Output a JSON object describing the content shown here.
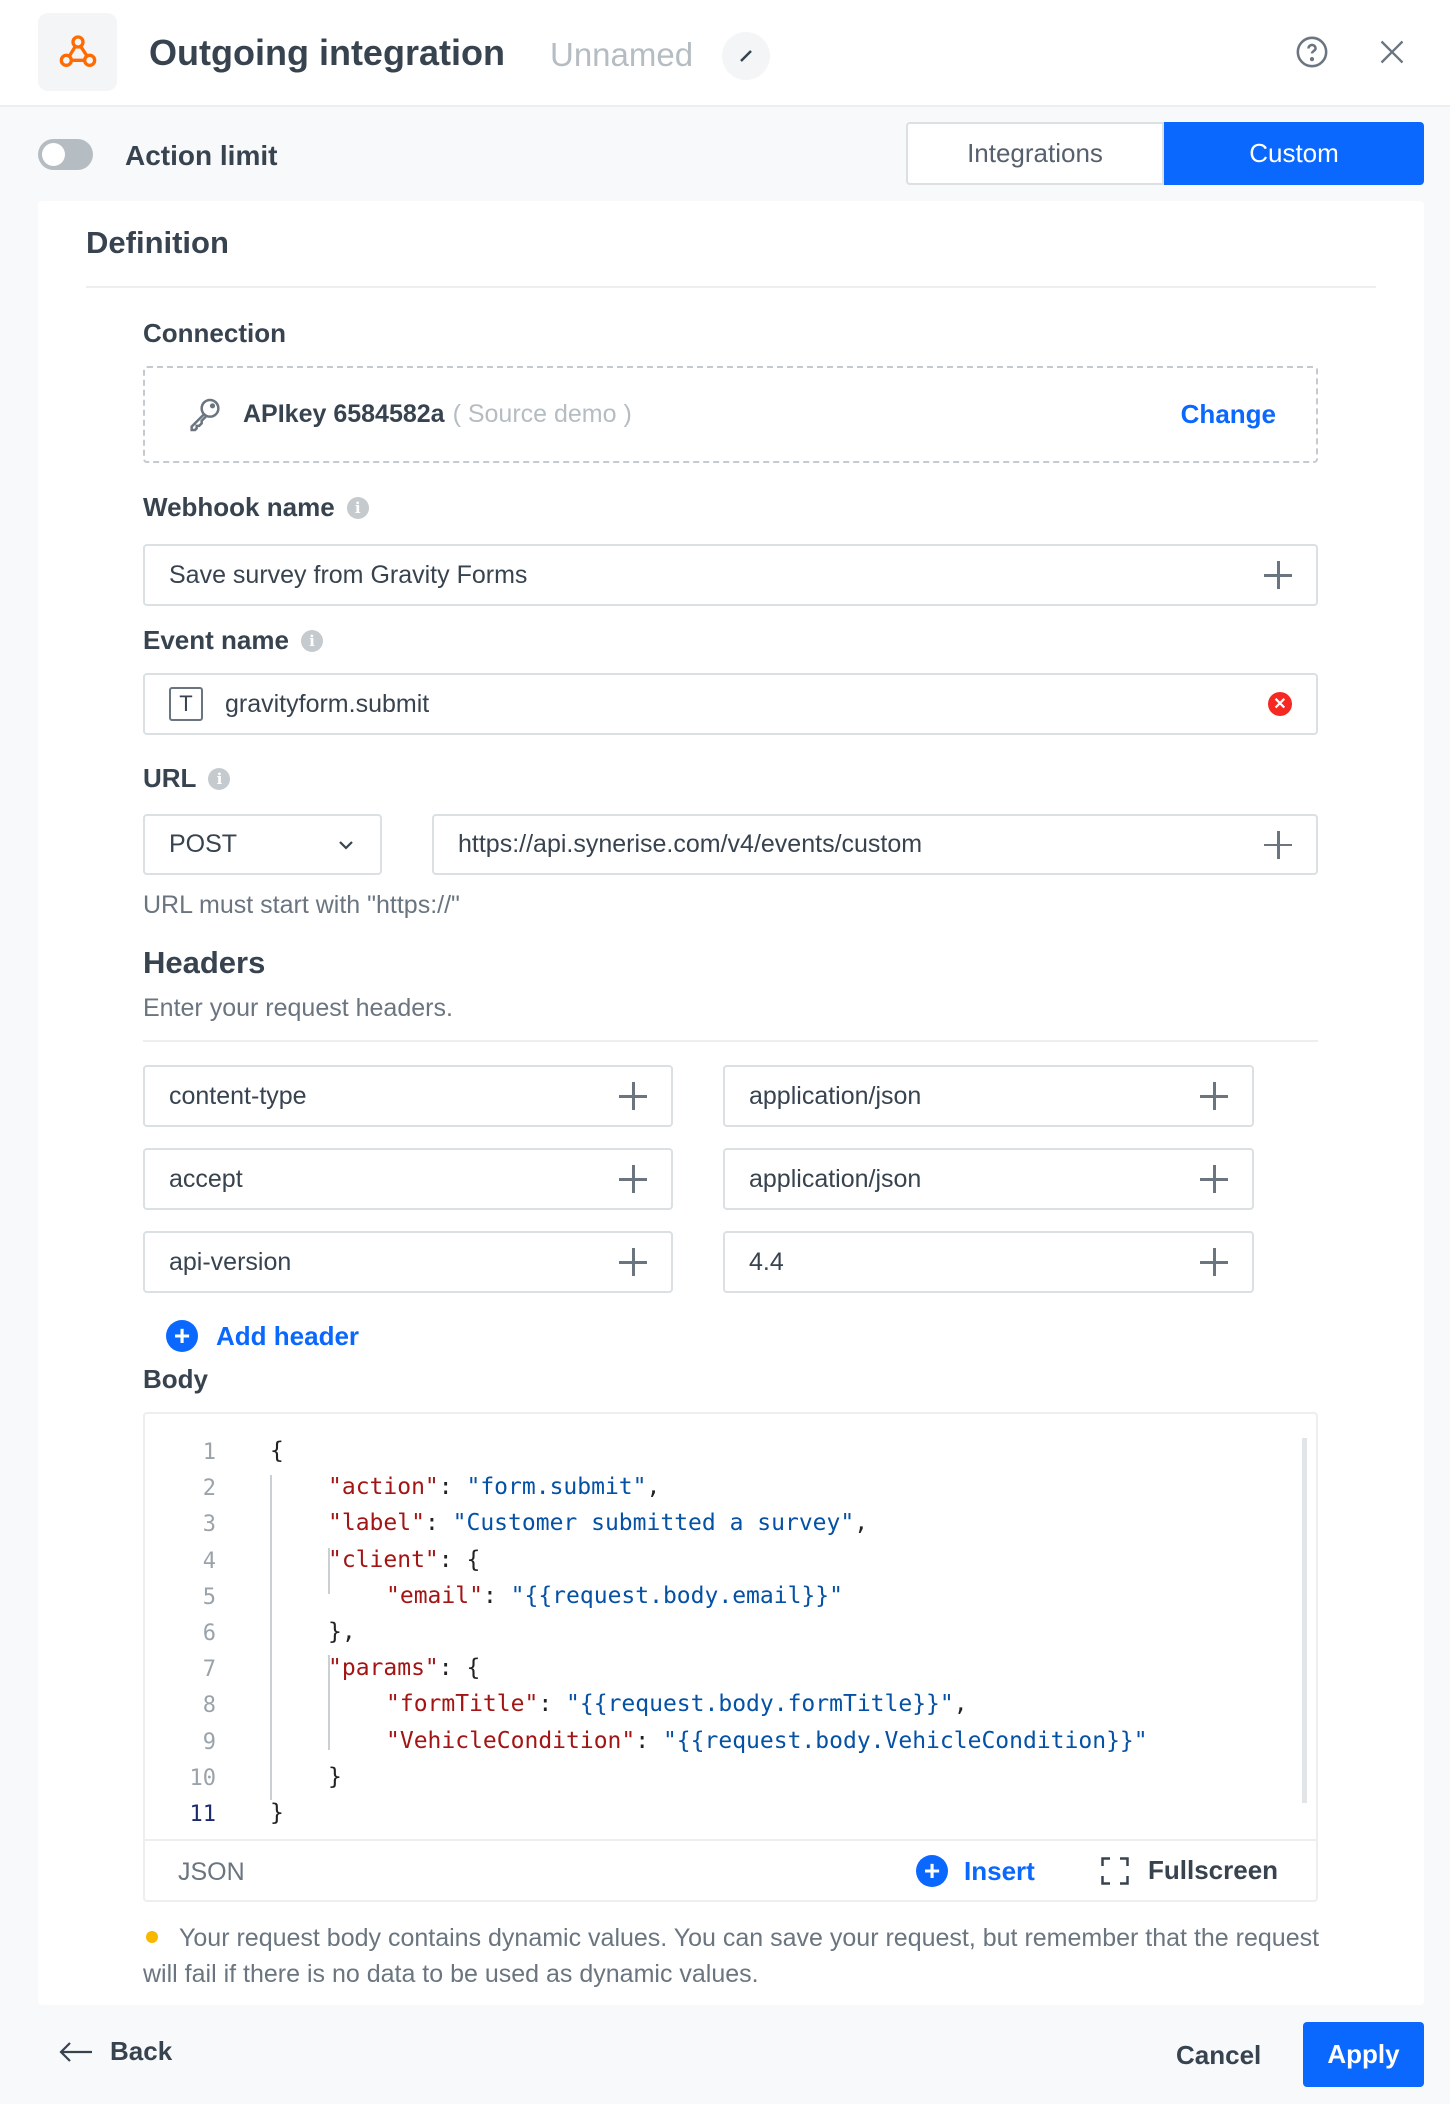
{
  "header": {
    "title": "Outgoing integration",
    "name": "Unnamed",
    "logo_icon": "webhook-icon",
    "help_icon": "question-circle-icon",
    "close_icon": "close-icon"
  },
  "toolbar": {
    "action_limit_label": "Action limit",
    "action_limit_enabled": false,
    "tabs": [
      {
        "label": "Integrations",
        "active": false
      },
      {
        "label": "Custom",
        "active": true
      }
    ]
  },
  "definition": {
    "title": "Definition",
    "connection": {
      "label": "Connection",
      "name": "APIkey 6584582a",
      "source": "( Source demo )",
      "change_label": "Change"
    },
    "webhook_name": {
      "label": "Webhook name",
      "value": "Save survey from Gravity Forms"
    },
    "event_name": {
      "label": "Event name",
      "value": "gravityform.submit"
    },
    "url": {
      "label": "URL",
      "method": "POST",
      "value": "https://api.synerise.com/v4/events/custom",
      "hint": "URL must start with \"https://\""
    },
    "headers": {
      "title": "Headers",
      "subtitle": "Enter your request headers.",
      "rows": [
        {
          "key": "content-type",
          "value": "application/json"
        },
        {
          "key": "accept",
          "value": "application/json"
        },
        {
          "key": "api-version",
          "value": "4.4"
        }
      ],
      "add_label": "Add header"
    },
    "body": {
      "label": "Body",
      "language": "JSON",
      "insert_label": "Insert",
      "fullscreen_label": "Fullscreen",
      "line_numbers": [
        "1",
        "2",
        "3",
        "4",
        "5",
        "6",
        "7",
        "8",
        "9",
        "10",
        "11"
      ],
      "lines": [
        [
          {
            "t": "p",
            "v": "{"
          }
        ],
        [
          {
            "t": "k",
            "v": "\"action\""
          },
          {
            "t": "p",
            "v": ": "
          },
          {
            "t": "s",
            "v": "\"form.submit\""
          },
          {
            "t": "p",
            "v": ","
          }
        ],
        [
          {
            "t": "k",
            "v": "\"label\""
          },
          {
            "t": "p",
            "v": ": "
          },
          {
            "t": "s",
            "v": "\"Customer submitted a survey\""
          },
          {
            "t": "p",
            "v": ","
          }
        ],
        [
          {
            "t": "k",
            "v": "\"client\""
          },
          {
            "t": "p",
            "v": ": {"
          }
        ],
        [
          {
            "t": "k",
            "v": "\"email\""
          },
          {
            "t": "p",
            "v": ": "
          },
          {
            "t": "s",
            "v": "\"{{request.body.email}}\""
          }
        ],
        [
          {
            "t": "p",
            "v": "},"
          }
        ],
        [
          {
            "t": "k",
            "v": "\"params\""
          },
          {
            "t": "p",
            "v": ": {"
          }
        ],
        [
          {
            "t": "k",
            "v": "\"formTitle\""
          },
          {
            "t": "p",
            "v": ": "
          },
          {
            "t": "s",
            "v": "\"{{request.body.formTitle}}\""
          },
          {
            "t": "p",
            "v": ","
          }
        ],
        [
          {
            "t": "k",
            "v": "\"VehicleCondition\""
          },
          {
            "t": "p",
            "v": ": "
          },
          {
            "t": "s",
            "v": "\"{{request.body.VehicleCondition}}\""
          }
        ],
        [
          {
            "t": "p",
            "v": "}"
          }
        ],
        [
          {
            "t": "p",
            "v": "}"
          }
        ]
      ],
      "indents": [
        0,
        1,
        1,
        1,
        2,
        1,
        1,
        2,
        2,
        1,
        0
      ],
      "warning": "Your request body contains dynamic values. You can save your request, but remember that the request will fail if there is no data to be used as dynamic values."
    }
  },
  "footer": {
    "back_label": "Back",
    "cancel_label": "Cancel",
    "apply_label": "Apply"
  },
  "colors": {
    "accent": "#0b68ff",
    "warning_dot": "#fab700",
    "error": "#f52922",
    "logo": "#ff6b00"
  }
}
